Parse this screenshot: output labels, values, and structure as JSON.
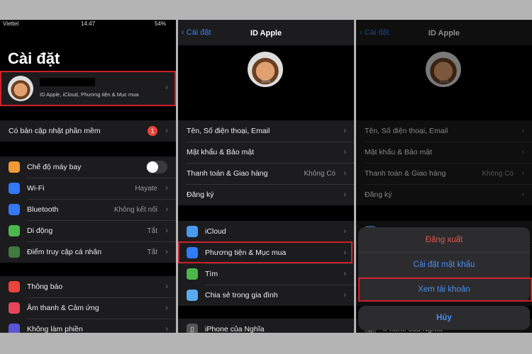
{
  "panel1": {
    "status": {
      "carrier": "Viettel",
      "time": "14:47",
      "battery": "54%"
    },
    "title": "Cài đặt",
    "profile_subtitle": "ID Apple, iCloud, Phương tiện & Mục mua",
    "update": {
      "label": "Có bản cập nhật phần mềm",
      "badge": "1"
    },
    "group1": [
      {
        "label": "Chế độ máy bay",
        "value": "",
        "color": "#f09a37",
        "icon": "airplane-icon"
      },
      {
        "label": "Wi-Fi",
        "value": "Hayate",
        "color": "#3478f6",
        "icon": "wifi-icon"
      },
      {
        "label": "Bluetooth",
        "value": "Không kết nối",
        "color": "#3478f6",
        "icon": "bluetooth-icon"
      },
      {
        "label": "Di động",
        "value": "Tắt",
        "color": "#4cb84c",
        "icon": "cellular-icon"
      },
      {
        "label": "Điểm truy cập cá nhân",
        "value": "Tắt",
        "color": "#3f7a3f",
        "icon": "hotspot-icon"
      }
    ],
    "group2": [
      {
        "label": "Thông báo",
        "color": "#e8453c",
        "icon": "notifications-icon"
      },
      {
        "label": "Âm thanh & Cảm ứng",
        "color": "#e8455c",
        "icon": "sound-icon"
      },
      {
        "label": "Không làm phiền",
        "color": "#5856d6",
        "icon": "moon-icon"
      }
    ]
  },
  "panel2": {
    "back": "Cài đặt",
    "title": "ID Apple",
    "edit": "SỬA",
    "group1": [
      "Tên, Số điện thoại, Email",
      "Mật khẩu & Bảo mật",
      "Thanh toán & Giao hàng",
      "Đăng ký"
    ],
    "payment_value": "Không Có",
    "group2": [
      {
        "label": "iCloud",
        "color": "#4a9af0",
        "icon": "icloud-icon"
      },
      {
        "label": "Phương tiện & Mục mua",
        "color": "#2f7cf6",
        "icon": "app-store-icon"
      },
      {
        "label": "Tìm",
        "color": "#4cb84c",
        "icon": "find-my-icon"
      },
      {
        "label": "Chia sẻ trong gia đình",
        "color": "#5aaaf0",
        "icon": "family-icon"
      }
    ],
    "device": "iPhone của Nghĩa"
  },
  "panel3": {
    "sheet": {
      "sign_out": "Đăng xuất",
      "password": "Cài đặt mật khẩu",
      "view_account": "Xem tài khoản",
      "cancel": "Hủy"
    }
  }
}
